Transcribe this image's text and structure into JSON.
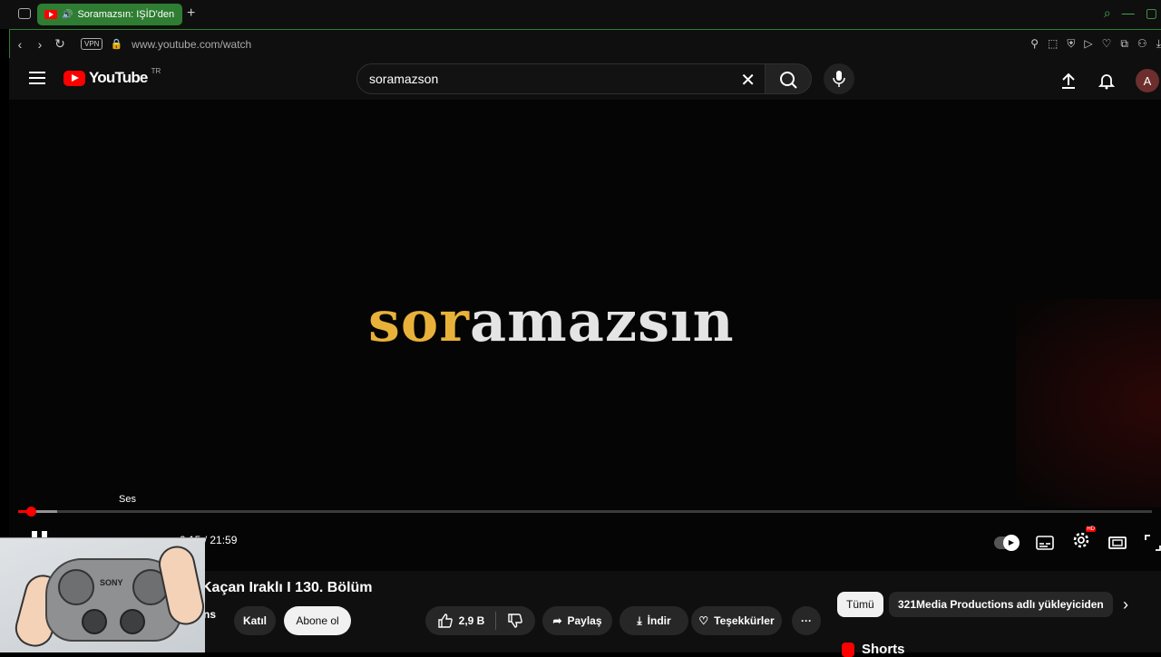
{
  "browser": {
    "tab_title": "Soramazsın: IŞİD'den",
    "new_tab": "+",
    "vpn_badge": "VPN",
    "url": "www.youtube.com/watch"
  },
  "yt_header": {
    "logo_text": "YouTube",
    "country_code": "TR",
    "search_value": "soramazson",
    "avatar_letter": "A"
  },
  "player": {
    "brand_part1": "sor",
    "brand_part2": "amazsın",
    "tooltip": "Ses",
    "time_display": "0:15 / 21:59",
    "progress_fraction": 0.011,
    "buffer_fraction": 0.034,
    "hd_badge": "HD"
  },
  "video": {
    "title": "Kaçan Iraklı I 130. Bölüm",
    "channel_fragment": "ns",
    "join_label": "Katıl",
    "subscribe_label": "Abone ol",
    "like_count": "2,9 B",
    "share_label": "Paylaş",
    "download_label": "İndir",
    "thanks_label": "Teşekkürler",
    "more_label": "···"
  },
  "side_chips": {
    "all_label": "Tümü",
    "uploader_label": "321Media Productions adlı yükleyiciden",
    "shorts_label": "Shorts"
  },
  "webcam": {
    "pad_brand": "SONY"
  },
  "colors": {
    "brand_yellow": "#e8b23a",
    "brand_white": "#e4e4e4",
    "youtube_red": "#ff0000",
    "tab_green": "#2e7d32"
  }
}
